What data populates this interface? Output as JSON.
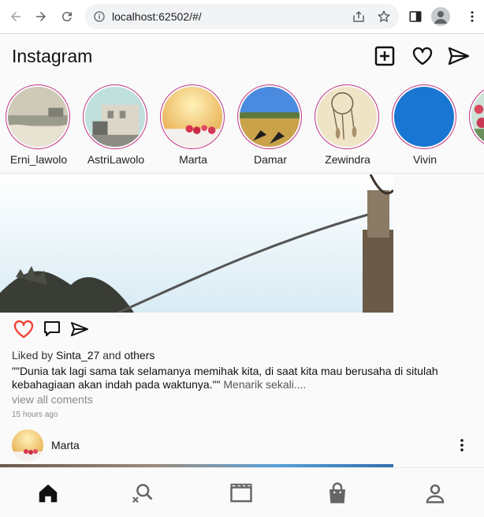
{
  "browser": {
    "url": "localhost:62502/#/"
  },
  "app": {
    "title": "Instagram",
    "actions": [
      "add-post-icon",
      "heart-icon",
      "send-icon"
    ]
  },
  "stories": [
    {
      "name": "Erni_lawolo",
      "thumb": "beach"
    },
    {
      "name": "AstriLawolo",
      "thumb": "building"
    },
    {
      "name": "Marta",
      "thumb": "berries"
    },
    {
      "name": "Damar",
      "thumb": "field"
    },
    {
      "name": "Zewindra",
      "thumb": "dreamcatcher"
    },
    {
      "name": "Vivin",
      "thumb": "blue",
      "color": "#1976d2"
    },
    {
      "name": "",
      "thumb": "flowers"
    }
  ],
  "post": {
    "liked_prefix": "Liked by",
    "liked_user": "Sinta_27",
    "liked_and": "and",
    "liked_others": "others",
    "caption": "\"\"Dunia tak lagi sama tak selamanya memihak kita, di saat kita mau berusaha di situlah kebahagiaan akan indah pada waktunya.\"\"",
    "caption_more": "Menarik sekali....",
    "view_comments": "view all coments",
    "time": "15 hours ago",
    "liked_color": "#f0443a"
  },
  "next_post": {
    "user": "Marta"
  },
  "bottom_nav": [
    "home-icon",
    "search-icon",
    "reels-icon",
    "shop-icon",
    "profile-icon"
  ]
}
